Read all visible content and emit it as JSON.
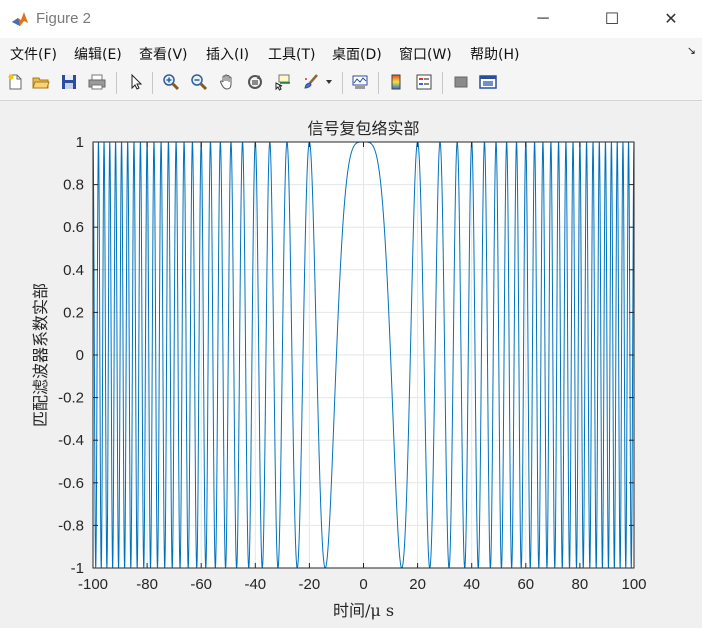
{
  "window": {
    "title": "Figure 2",
    "minimize_glyph": "─",
    "maximize_glyph": "☐",
    "close_glyph": "✕"
  },
  "menu": {
    "items": [
      "文件(F)",
      "编辑(E)",
      "查看(V)",
      "插入(I)",
      "工具(T)",
      "桌面(D)",
      "窗口(W)",
      "帮助(H)"
    ],
    "overflow_glyph": "↘"
  },
  "toolbar": {
    "icons": [
      "new-figure-icon",
      "open-file-icon",
      "save-icon",
      "print-icon",
      "select-arrow-icon",
      "zoom-in-icon",
      "zoom-out-icon",
      "pan-hand-icon",
      "rotate-3d-icon",
      "data-cursor-icon",
      "brush-icon",
      "link-plot-icon",
      "colorbar-icon",
      "legend-icon",
      "hide-plot-tools-icon",
      "show-plot-tools-icon"
    ]
  },
  "colors": {
    "line": "#0072bd",
    "axes_bg": "#ffffff",
    "grid": "#e6e6e6",
    "figure_bg": "#f0f0f0",
    "axis": "#262626"
  },
  "chart_data": {
    "type": "line",
    "title": "信号复包络实部",
    "xlabel": "时间/μ s",
    "ylabel": "匹配滤波器系数实部",
    "xlim": [
      -100,
      100
    ],
    "ylim": [
      -1,
      1
    ],
    "xticks": [
      -100,
      -80,
      -60,
      -40,
      -20,
      0,
      20,
      40,
      60,
      80,
      100
    ],
    "yticks": [
      1,
      0.8,
      0.6,
      0.4,
      0.2,
      0,
      -0.2,
      -0.4,
      -0.6,
      -0.8,
      -1
    ],
    "grid": true,
    "series": [
      {
        "function": "cos(pi * K * t^2)",
        "K": 0.005,
        "t_range": [
          -100,
          100
        ],
        "samples": 4001
      }
    ]
  }
}
